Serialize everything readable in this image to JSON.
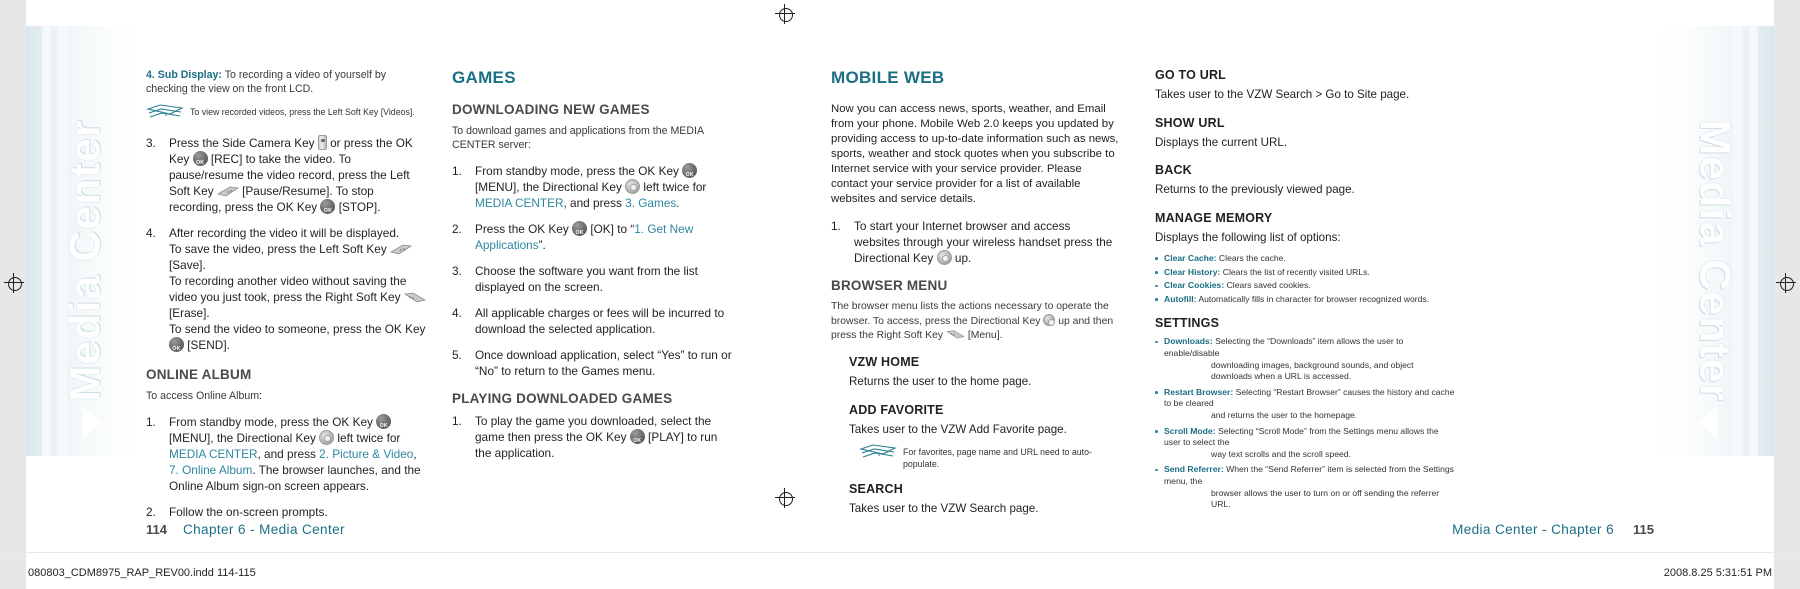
{
  "spread": {
    "left_page_number": "114",
    "right_page_number": "115",
    "left_running_head": "Chapter 6 - Media Center",
    "right_running_head": "Media Center - Chapter 6",
    "side_band_title": "Media Center",
    "plate_left": "080803_CDM8975_RAP_REV00.indd   114-115",
    "plate_right": "2008.8.25   5:31:51 PM"
  },
  "colors": {
    "accent_teal": "#1b6f85",
    "link_teal": "#2c86a0",
    "body_dark": "#231f20",
    "subhead_gray": "#4a4a4a"
  },
  "column1": {
    "sub_display_label": "4. Sub Display:",
    "sub_display_text": " To recording a video of yourself by checking the view on the front LCD.",
    "note1": "To view recorded videos, press the Left Soft Key       [Videos].",
    "step3": {
      "num": "3.",
      "part1": "Press the Side Camera Key ",
      "part2": " or press the OK Key ",
      "part3": " [REC] to take the video. To pause/resume the video record, press the Left Soft Key ",
      "part4": " [Pause/Resume]. To stop recording, press the OK Key ",
      "part5": " [STOP]."
    },
    "step4": {
      "num": "4.",
      "line1": "After recording the video it will be displayed.",
      "line2a": "To save the video, press the Left Soft Key ",
      "line2b": " [Save].",
      "line3": "To recording another video without saving the video you just took, press the Right Soft Key ",
      "line3b": " [Erase].",
      "line4a": "To send the video to someone, press the OK Key ",
      "line4b": " [SEND]."
    },
    "online_album_heading": "ONLINE ALBUM",
    "online_album_lead": "To access Online Album:",
    "oa_step1": {
      "num": "1.",
      "part1": "From standby mode, press the OK Key ",
      "part2": " [MENU], the Directional Key ",
      "part3": " left twice for ",
      "link1": "MEDIA CENTER",
      "part4": ", and press ",
      "link2": "2. Picture & Video",
      "part5": ", ",
      "link3": "7. Online Album",
      "part6": ". The browser launches, and the Online Album sign-on screen appears."
    },
    "oa_step2": {
      "num": "2.",
      "text": "Follow the on-screen prompts."
    }
  },
  "column2": {
    "section_heading": "GAMES",
    "sub_heading_1": "DOWNLOADING NEW GAMES",
    "lead_1": "To download games and applications from the MEDIA CENTER server:",
    "steps": [
      {
        "num": "1.",
        "part1": "From standby mode, press the OK Key ",
        "part2": " [MENU], the Directional Key ",
        "part3": " left twice for ",
        "link1": "MEDIA CENTER",
        "part4": ", and press ",
        "link2": "3. Games",
        "part5": "."
      },
      {
        "num": "2.",
        "part1": "Press the OK Key ",
        "part2": " [OK] to “",
        "link1": "1. Get New Applications",
        "part3": "”."
      },
      {
        "num": "3.",
        "text": "Choose the software you want from the list displayed on the screen."
      },
      {
        "num": "4.",
        "text": "All applicable charges or fees will be incurred to download the selected application."
      },
      {
        "num": "5.",
        "text": "Once download application, select “Yes” to run or “No” to return to the Games menu."
      }
    ],
    "sub_heading_2": "PLAYING DOWNLOADED GAMES",
    "play_step": {
      "num": "1.",
      "part1": "To play the game you downloaded, select the game then press the OK Key ",
      "part2": " [PLAY] to run the application."
    }
  },
  "column3": {
    "section_heading": "MOBILE WEB",
    "intro": "Now you can access news, sports, weather, and Email from your phone. Mobile Web 2.0 keeps you updated by providing access to up-to-date information such as news, sports, weather and stock quotes when you subscribe to Internet service with your service provider. Please contact your service provider for a list of available websites and service details.",
    "step1": {
      "num": "1.",
      "part1": "To start your Internet browser and access websites through your wireless handset press the Directional Key ",
      "part2": " up."
    },
    "browser_menu_heading": "BROWSER MENU",
    "browser_menu_lead_a": "The browser menu lists the actions necessary to operate the browser. To access, press the Directional Key ",
    "browser_menu_lead_b": " up and then press the Right Soft Key ",
    "browser_menu_lead_c": " [Menu].",
    "items": [
      {
        "title": "VZW HOME",
        "desc": "Returns the user to the home page."
      },
      {
        "title": "ADD FAVORITE",
        "desc": "Takes user to the VZW Add Favorite page.",
        "note": "For favorites, page name and URL need to auto-populate."
      },
      {
        "title": "SEARCH",
        "desc": "Takes user to the VZW Search page."
      }
    ]
  },
  "column4": {
    "items": [
      {
        "title": "GO TO URL",
        "desc": "Takes user to the VZW Search > Go to Site page."
      },
      {
        "title": "SHOW URL",
        "desc": "Displays the current URL."
      },
      {
        "title": "BACK",
        "desc": "Returns to the previously viewed page."
      },
      {
        "title": "MANAGE MEMORY",
        "desc": "Displays the following list of options:"
      }
    ],
    "manage_memory_bullets": [
      {
        "label": "Clear Cache:",
        "text": " Clears the cache."
      },
      {
        "label": "Clear History:",
        "text": " Clears the list of recently visited URLs."
      },
      {
        "label": "Clear Cookies:",
        "text": " Clears saved cookies."
      },
      {
        "label": "Autofill:",
        "text": " Automatically fills in character for browser recognized words."
      }
    ],
    "settings_heading": "SETTINGS",
    "settings_bullets": [
      {
        "label": "Downloads:",
        "text": " Selecting the “Downloads” item allows the user to enable/disable",
        "cont": "downloading images, background sounds, and object downloads when a URL is accessed."
      },
      {
        "label": "Restart Browser:",
        "text": " Selecting “Restart Browser” causes the history and cache to be cleared",
        "cont": "and returns the user to the homepage."
      },
      {
        "label": "Scroll Mode:",
        "text": " Selecting “Scroll Mode” from the Settings menu allows the user to select the",
        "cont": "way text scrolls and the scroll speed."
      },
      {
        "label": "Send Referrer:",
        "text": " When the “Send Referrer” item is selected from the Settings menu, the",
        "cont": "browser allows the user to turn on or off sending the referrer URL."
      }
    ]
  },
  "icons": {
    "ok_key": "ok-key-icon",
    "directional_key": "directional-key-icon",
    "side_camera_key": "side-camera-key-icon",
    "left_soft_key": "left-soft-key-icon",
    "right_soft_key": "right-soft-key-icon",
    "note_card": "note-card-icon",
    "registration": "registration-mark-icon"
  }
}
